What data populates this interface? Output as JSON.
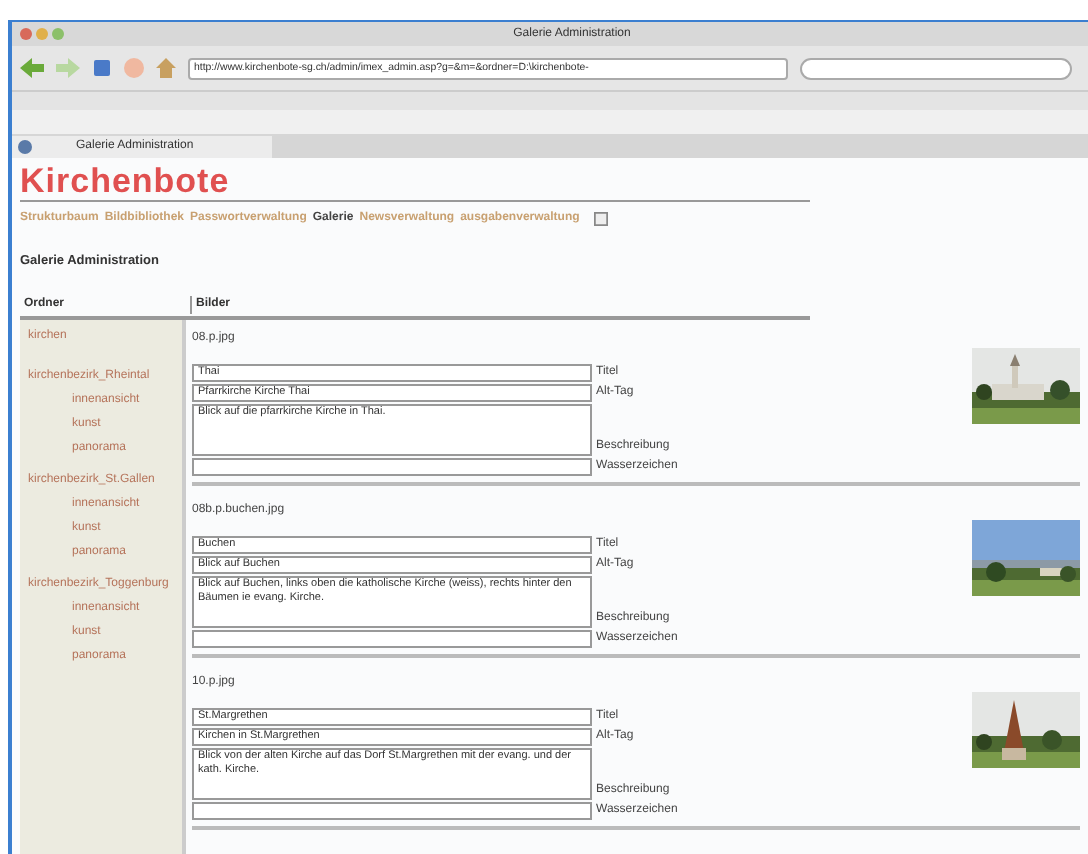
{
  "window": {
    "title": "Galerie Administration"
  },
  "toolbar": {
    "address": "http://www.kirchenbote-sg.ch/admin/imex_admin.asp?g=&m=&ordner=D:\\kirchenbote-"
  },
  "tab": {
    "label": "Galerie Administration",
    "selected": true
  },
  "site": {
    "logo": "Kirchenbote",
    "nav": [
      {
        "label": "Strukturbaum",
        "selected": false
      },
      {
        "label": "Bildbibliothek",
        "selected": false
      },
      {
        "label": "Passwortverwaltung",
        "selected": false
      },
      {
        "label": "Galerie",
        "selected": true
      },
      {
        "label": "Newsverwaltung",
        "selected": false
      },
      {
        "label": "ausgabenverwaltung",
        "selected": false
      }
    ],
    "heading": "Galerie Administration"
  },
  "table": {
    "columns": [
      "Ordner",
      "Bilder"
    ]
  },
  "folders": [
    {
      "label": "kirchen"
    },
    {
      "label": "kirchenbezirk_Rheintal",
      "children": [
        {
          "label": "innenansicht"
        },
        {
          "label": "kunst"
        },
        {
          "label": "panorama"
        }
      ]
    },
    {
      "label": "kirchenbezirk_St.Gallen",
      "children": [
        {
          "label": "innenansicht"
        },
        {
          "label": "kunst"
        },
        {
          "label": "panorama"
        }
      ]
    },
    {
      "label": "kirchenbezirk_Toggenburg",
      "children": [
        {
          "label": "innenansicht"
        },
        {
          "label": "kunst"
        },
        {
          "label": "panorama"
        }
      ]
    }
  ],
  "images": [
    {
      "file": "08.p.jpg",
      "title": "Thai",
      "alt": "Pfarrkirche Kirche Thai",
      "description": "Blick auf die pfarrkirche Kirche in Thai.",
      "kind": "picture",
      "labels": {
        "title": "Titel",
        "alt": "Alt-Tag",
        "description": "Beschreibung",
        "watermark": "Wasserzeichen"
      }
    },
    {
      "file": "08b.p.buchen.jpg",
      "title": "Buchen",
      "alt": "Blick auf Buchen",
      "description": "Blick auf Buchen, links oben die katholische Kirche (weiss), rechts hinter den Bäumen ie evang. Kirche.",
      "kind": "picture",
      "labels": {
        "title": "Titel",
        "alt": "Alt-Tag",
        "description": "Beschreibung",
        "watermark": "Wasserzeichen"
      }
    },
    {
      "file": "10.p.jpg",
      "title": "St.Margrethen",
      "alt": "Kirchen in St.Margrethen",
      "description": "Blick von der alten Kirche auf das Dorf St.Margrethen mit der evang. und der kath. Kirche.",
      "kind": "picture",
      "labels": {
        "title": "Titel",
        "alt": "Alt-Tag",
        "description": "Beschreibung",
        "watermark": "Wasserzeichen"
      }
    }
  ]
}
